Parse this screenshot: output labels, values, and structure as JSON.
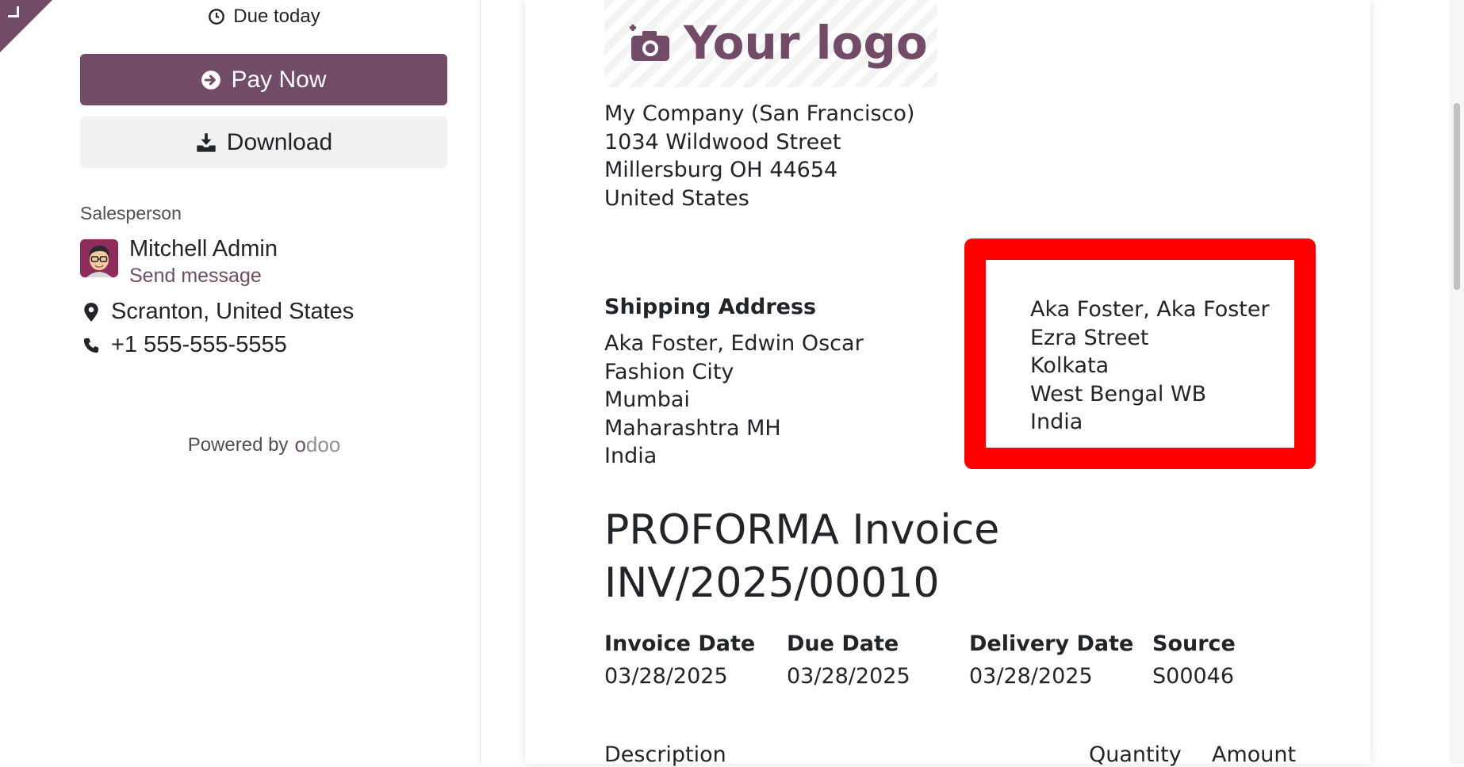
{
  "sidebar": {
    "due_text": "Due today",
    "pay_button_label": "Pay Now",
    "download_button_label": "Download",
    "salesperson_label": "Salesperson",
    "salesperson_name": "Mitchell Admin",
    "send_message_label": "Send message",
    "location": "Scranton, United States",
    "phone": "+1 555-555-5555",
    "powered_by_label": "Powered by",
    "brand_name": "odoo"
  },
  "document": {
    "logo_text": "Your logo",
    "company_lines": [
      "My Company (San Francisco)",
      "1034 Wildwood Street",
      "Millersburg OH 44654",
      "United States"
    ],
    "shipping_title": "Shipping Address",
    "shipping_lines": [
      "Aka Foster, Edwin Oscar",
      "Fashion City",
      "Mumbai",
      "Maharashtra MH",
      "India"
    ],
    "billing_lines": [
      "Aka Foster, Aka Foster",
      "Ezra Street",
      "Kolkata",
      "West Bengal WB",
      "India"
    ],
    "title_line1": "PROFORMA Invoice",
    "title_line2": "INV/2025/00010",
    "meta": [
      {
        "label": "Invoice Date",
        "value": "03/28/2025"
      },
      {
        "label": "Due Date",
        "value": "03/28/2025"
      },
      {
        "label": "Delivery Date",
        "value": "03/28/2025"
      },
      {
        "label": "Source",
        "value": "S00046"
      }
    ],
    "table_headers": [
      "Description",
      "Quantity",
      "Amount"
    ]
  },
  "colors": {
    "brand": "#714b67",
    "highlight": "#ff0000",
    "download_bg": "#f1f1f1"
  },
  "icons": {
    "due": "clock-icon",
    "pay": "arrow-circle-right-icon",
    "download": "download-icon",
    "location": "map-marker-icon",
    "phone": "phone-icon",
    "logo": "camera-plus-icon",
    "corner": "collapse-corner-icon"
  }
}
